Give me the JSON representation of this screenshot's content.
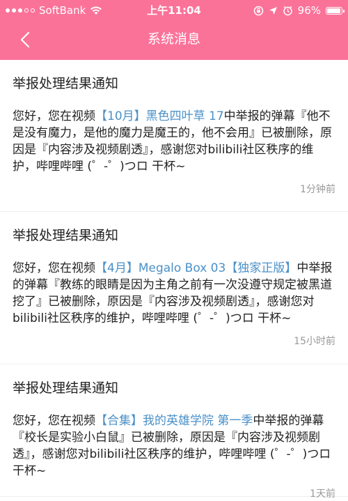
{
  "status_bar": {
    "carrier": "SoftBank",
    "time": "上午11:04",
    "battery_text": "96%",
    "battery_level": 0.96
  },
  "nav": {
    "title": "系统消息",
    "back_icon": "chevron-left-icon"
  },
  "colors": {
    "header_bg": "#fb7299",
    "link": "#4a90c8",
    "time_text": "#999999"
  },
  "messages": [
    {
      "title": "举报处理结果通知",
      "prefix": "您好，您在视频",
      "video_link": "【10月】黑色四叶草 17",
      "suffix": "中举报的弹幕『他不是没有魔力，是他的魔力是魔王的，他不会用』已被删除，原因是『内容涉及视频剧透』，感谢您对bilibili社区秩序的维护，哔哩哔哩 (゜-゜)つロ 干杯~",
      "time": "1分钟前"
    },
    {
      "title": "举报处理结果通知",
      "prefix": "您好，您在视频",
      "video_link": "【4月】Megalo Box 03【独家正版】",
      "suffix": "中举报的弹幕『教练的眼睛是因为主角之前有一次没遵守规定被黑道挖了』已被删除，原因是『内容涉及视频剧透』，感谢您对bilibili社区秩序的维护，哔哩哔哩 (゜-゜)つロ 干杯~",
      "time": "15小时前"
    },
    {
      "title": "举报处理结果通知",
      "prefix": "您好，您在视频",
      "video_link": "【合集】我的英雄学院 第一季",
      "suffix": "中举报的弹幕『校长是实验小白鼠』已被删除，原因是『内容涉及视频剧透』，感谢您对bilibili社区秩序的维护，哔哩哔哩 (゜-゜)つロ 干杯~",
      "time": "1天前"
    }
  ]
}
